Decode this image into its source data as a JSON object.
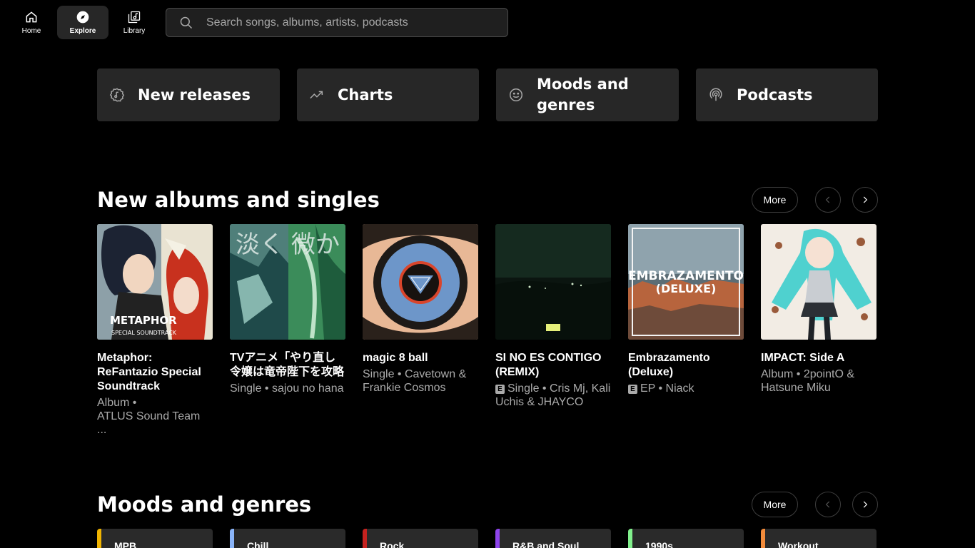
{
  "nav": {
    "items": [
      {
        "label": "Home",
        "icon": "home-icon",
        "active": false
      },
      {
        "label": "Explore",
        "icon": "compass-icon",
        "active": true
      },
      {
        "label": "Library",
        "icon": "library-icon",
        "active": false
      }
    ]
  },
  "search": {
    "placeholder": "Search songs, albums, artists, podcasts"
  },
  "categories": [
    {
      "label": "New releases",
      "icon": "new-releases-icon"
    },
    {
      "label": "Charts",
      "icon": "trending-icon"
    },
    {
      "label": "Moods and genres",
      "icon": "smiley-icon"
    },
    {
      "label": "Podcasts",
      "icon": "podcast-icon"
    }
  ],
  "new_albums": {
    "title": "New albums and singles",
    "more_label": "More",
    "items": [
      {
        "title": "Metaphor: ReFantazio Special Soundtrack",
        "sub1": "Album •",
        "sub2": "ATLUS Sound Team ...",
        "explicit": false
      },
      {
        "title": "TVアニメ「やり直し令嬢は竜帝陛下を攻略",
        "sub1": "Single • sajou no hana",
        "sub2": "",
        "explicit": false
      },
      {
        "title": "magic 8 ball",
        "sub1": "Single • Cavetown &",
        "sub2": "Frankie Cosmos",
        "explicit": false
      },
      {
        "title": "SI NO ES CONTIGO (REMIX)",
        "sub1": "Single • Cris Mj, Kali",
        "sub2": "Uchis & JHAYCO",
        "explicit": true
      },
      {
        "title": "Embrazamento (Deluxe)",
        "sub1": "EP • Niack",
        "sub2": "",
        "explicit": true
      },
      {
        "title": "IMPACT: Side A",
        "sub1": "Album • 2pointO &",
        "sub2": "Hatsune Miku",
        "explicit": false
      }
    ]
  },
  "moods": {
    "title": "Moods and genres",
    "more_label": "More",
    "items": [
      {
        "label": "MPB",
        "color": "#f0b400"
      },
      {
        "label": "Chill",
        "color": "#8ab4f8"
      },
      {
        "label": "Rock",
        "color": "#c5221f"
      },
      {
        "label": "R&B and Soul",
        "color": "#8e44ec"
      },
      {
        "label": "1990s",
        "color": "#81f08c"
      },
      {
        "label": "Workout",
        "color": "#f28b3b"
      }
    ]
  },
  "album_art_text": {
    "metaphor_logo": "METAPHOR",
    "metaphor_sub": "SPECIAL SOUNDTRACK",
    "embrazamento_1": "EMBRAZAMENTO",
    "embrazamento_2": "(DELUXE)"
  }
}
